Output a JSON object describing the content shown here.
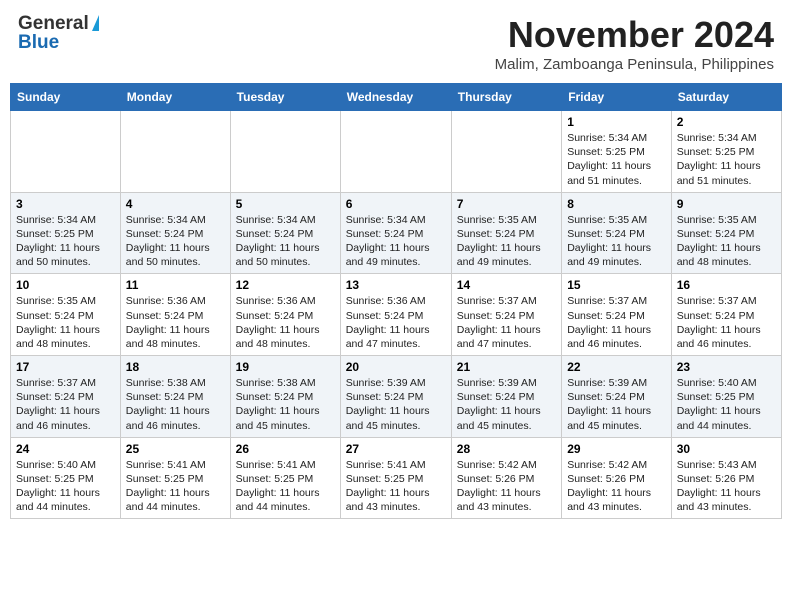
{
  "header": {
    "logo_general": "General",
    "logo_blue": "Blue",
    "month_title": "November 2024",
    "location": "Malim, Zamboanga Peninsula, Philippines"
  },
  "weekdays": [
    "Sunday",
    "Monday",
    "Tuesday",
    "Wednesday",
    "Thursday",
    "Friday",
    "Saturday"
  ],
  "weeks": [
    [
      {
        "day": "",
        "sunrise": "",
        "sunset": "",
        "daylight": ""
      },
      {
        "day": "",
        "sunrise": "",
        "sunset": "",
        "daylight": ""
      },
      {
        "day": "",
        "sunrise": "",
        "sunset": "",
        "daylight": ""
      },
      {
        "day": "",
        "sunrise": "",
        "sunset": "",
        "daylight": ""
      },
      {
        "day": "",
        "sunrise": "",
        "sunset": "",
        "daylight": ""
      },
      {
        "day": "1",
        "sunrise": "Sunrise: 5:34 AM",
        "sunset": "Sunset: 5:25 PM",
        "daylight": "Daylight: 11 hours and 51 minutes."
      },
      {
        "day": "2",
        "sunrise": "Sunrise: 5:34 AM",
        "sunset": "Sunset: 5:25 PM",
        "daylight": "Daylight: 11 hours and 51 minutes."
      }
    ],
    [
      {
        "day": "3",
        "sunrise": "Sunrise: 5:34 AM",
        "sunset": "Sunset: 5:25 PM",
        "daylight": "Daylight: 11 hours and 50 minutes."
      },
      {
        "day": "4",
        "sunrise": "Sunrise: 5:34 AM",
        "sunset": "Sunset: 5:24 PM",
        "daylight": "Daylight: 11 hours and 50 minutes."
      },
      {
        "day": "5",
        "sunrise": "Sunrise: 5:34 AM",
        "sunset": "Sunset: 5:24 PM",
        "daylight": "Daylight: 11 hours and 50 minutes."
      },
      {
        "day": "6",
        "sunrise": "Sunrise: 5:34 AM",
        "sunset": "Sunset: 5:24 PM",
        "daylight": "Daylight: 11 hours and 49 minutes."
      },
      {
        "day": "7",
        "sunrise": "Sunrise: 5:35 AM",
        "sunset": "Sunset: 5:24 PM",
        "daylight": "Daylight: 11 hours and 49 minutes."
      },
      {
        "day": "8",
        "sunrise": "Sunrise: 5:35 AM",
        "sunset": "Sunset: 5:24 PM",
        "daylight": "Daylight: 11 hours and 49 minutes."
      },
      {
        "day": "9",
        "sunrise": "Sunrise: 5:35 AM",
        "sunset": "Sunset: 5:24 PM",
        "daylight": "Daylight: 11 hours and 48 minutes."
      }
    ],
    [
      {
        "day": "10",
        "sunrise": "Sunrise: 5:35 AM",
        "sunset": "Sunset: 5:24 PM",
        "daylight": "Daylight: 11 hours and 48 minutes."
      },
      {
        "day": "11",
        "sunrise": "Sunrise: 5:36 AM",
        "sunset": "Sunset: 5:24 PM",
        "daylight": "Daylight: 11 hours and 48 minutes."
      },
      {
        "day": "12",
        "sunrise": "Sunrise: 5:36 AM",
        "sunset": "Sunset: 5:24 PM",
        "daylight": "Daylight: 11 hours and 48 minutes."
      },
      {
        "day": "13",
        "sunrise": "Sunrise: 5:36 AM",
        "sunset": "Sunset: 5:24 PM",
        "daylight": "Daylight: 11 hours and 47 minutes."
      },
      {
        "day": "14",
        "sunrise": "Sunrise: 5:37 AM",
        "sunset": "Sunset: 5:24 PM",
        "daylight": "Daylight: 11 hours and 47 minutes."
      },
      {
        "day": "15",
        "sunrise": "Sunrise: 5:37 AM",
        "sunset": "Sunset: 5:24 PM",
        "daylight": "Daylight: 11 hours and 46 minutes."
      },
      {
        "day": "16",
        "sunrise": "Sunrise: 5:37 AM",
        "sunset": "Sunset: 5:24 PM",
        "daylight": "Daylight: 11 hours and 46 minutes."
      }
    ],
    [
      {
        "day": "17",
        "sunrise": "Sunrise: 5:37 AM",
        "sunset": "Sunset: 5:24 PM",
        "daylight": "Daylight: 11 hours and 46 minutes."
      },
      {
        "day": "18",
        "sunrise": "Sunrise: 5:38 AM",
        "sunset": "Sunset: 5:24 PM",
        "daylight": "Daylight: 11 hours and 46 minutes."
      },
      {
        "day": "19",
        "sunrise": "Sunrise: 5:38 AM",
        "sunset": "Sunset: 5:24 PM",
        "daylight": "Daylight: 11 hours and 45 minutes."
      },
      {
        "day": "20",
        "sunrise": "Sunrise: 5:39 AM",
        "sunset": "Sunset: 5:24 PM",
        "daylight": "Daylight: 11 hours and 45 minutes."
      },
      {
        "day": "21",
        "sunrise": "Sunrise: 5:39 AM",
        "sunset": "Sunset: 5:24 PM",
        "daylight": "Daylight: 11 hours and 45 minutes."
      },
      {
        "day": "22",
        "sunrise": "Sunrise: 5:39 AM",
        "sunset": "Sunset: 5:24 PM",
        "daylight": "Daylight: 11 hours and 45 minutes."
      },
      {
        "day": "23",
        "sunrise": "Sunrise: 5:40 AM",
        "sunset": "Sunset: 5:25 PM",
        "daylight": "Daylight: 11 hours and 44 minutes."
      }
    ],
    [
      {
        "day": "24",
        "sunrise": "Sunrise: 5:40 AM",
        "sunset": "Sunset: 5:25 PM",
        "daylight": "Daylight: 11 hours and 44 minutes."
      },
      {
        "day": "25",
        "sunrise": "Sunrise: 5:41 AM",
        "sunset": "Sunset: 5:25 PM",
        "daylight": "Daylight: 11 hours and 44 minutes."
      },
      {
        "day": "26",
        "sunrise": "Sunrise: 5:41 AM",
        "sunset": "Sunset: 5:25 PM",
        "daylight": "Daylight: 11 hours and 44 minutes."
      },
      {
        "day": "27",
        "sunrise": "Sunrise: 5:41 AM",
        "sunset": "Sunset: 5:25 PM",
        "daylight": "Daylight: 11 hours and 43 minutes."
      },
      {
        "day": "28",
        "sunrise": "Sunrise: 5:42 AM",
        "sunset": "Sunset: 5:26 PM",
        "daylight": "Daylight: 11 hours and 43 minutes."
      },
      {
        "day": "29",
        "sunrise": "Sunrise: 5:42 AM",
        "sunset": "Sunset: 5:26 PM",
        "daylight": "Daylight: 11 hours and 43 minutes."
      },
      {
        "day": "30",
        "sunrise": "Sunrise: 5:43 AM",
        "sunset": "Sunset: 5:26 PM",
        "daylight": "Daylight: 11 hours and 43 minutes."
      }
    ]
  ]
}
